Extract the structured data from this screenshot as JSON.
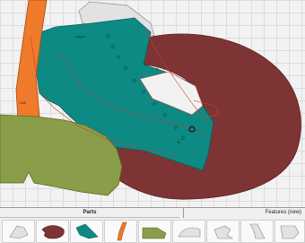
{
  "tabs": {
    "parts_label": "Parts",
    "features_label": "Features (new)"
  },
  "canvas": {
    "tag_left": "Left",
    "tag_upper": "Upper",
    "tag_a": "A",
    "tag_b": "B"
  },
  "colors": {
    "grid_background": "#f2f2f2",
    "grid_line": "#dcdcdc",
    "maroon_part": "#7e3434",
    "teal_part": "#0d8a84",
    "olive_part": "#8a9e49",
    "orange_part": "#ee7a2a",
    "light_part": "#e2e2e2",
    "outline": "#c04040",
    "cursor_marker": "#111111"
  },
  "thumbnails": [
    {
      "name": "light-piece",
      "icon": "light-gray-pattern-piece"
    },
    {
      "name": "maroon-vamp",
      "icon": "maroon-pattern-piece"
    },
    {
      "name": "teal-quarter",
      "icon": "teal-pattern-piece"
    },
    {
      "name": "orange-strip",
      "icon": "orange-pattern-piece"
    },
    {
      "name": "olive-heel",
      "icon": "olive-pattern-piece"
    },
    {
      "name": "light-toe",
      "icon": "light-gray-pattern-piece"
    },
    {
      "name": "light-hook",
      "icon": "light-gray-pattern-piece"
    },
    {
      "name": "light-slant",
      "icon": "light-gray-pattern-piece"
    },
    {
      "name": "light-corner",
      "icon": "light-gray-pattern-piece"
    }
  ]
}
